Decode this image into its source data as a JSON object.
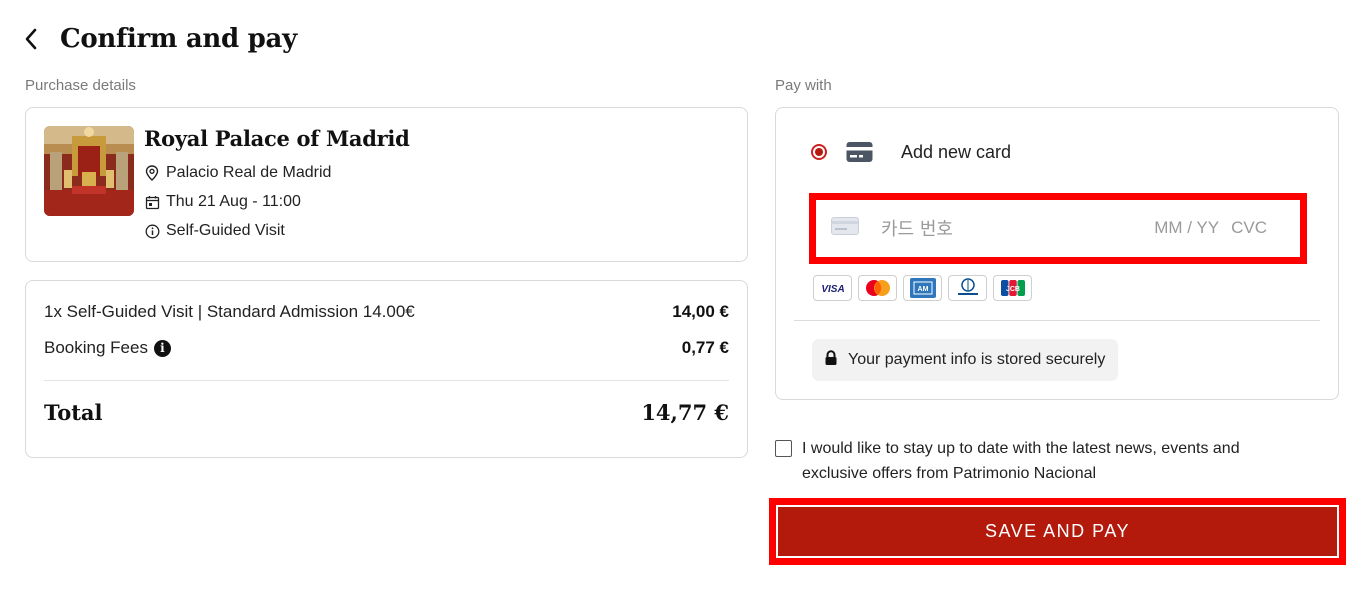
{
  "header": {
    "title": "Confirm and pay",
    "back_icon": "chevron-left-icon"
  },
  "purchase": {
    "section_label": "Purchase details",
    "venue_name": "Royal Palace of Madrid",
    "location": "Palacio Real de Madrid",
    "datetime": "Thu 21 Aug - 11:00",
    "visit_type": "Self-Guided Visit",
    "icons": {
      "location": "location-pin-icon",
      "date": "calendar-icon",
      "visit": "info-circle-icon"
    }
  },
  "pricing": {
    "items": [
      {
        "label": "1x Self-Guided Visit | Standard Admission 14.00€",
        "amount": "14,00 €"
      },
      {
        "label": "Booking Fees",
        "amount": "0,77 €"
      }
    ],
    "total_label": "Total",
    "total_amount": "14,77 €"
  },
  "payment": {
    "section_label": "Pay with",
    "add_card_label": "Add new card",
    "card_number_placeholder": "카드 번호",
    "expiry_placeholder": "MM / YY",
    "cvc_placeholder": "CVC",
    "brands": [
      "VISA",
      "Mastercard",
      "American Express",
      "Diners Club",
      "JCB"
    ],
    "secure_note": "Your payment info is stored securely"
  },
  "optin": {
    "label": "I would like to stay up to date with the latest news, events and exclusive offers from Patrimonio Nacional",
    "checked": false
  },
  "pay_button": {
    "label": "SAVE AND PAY"
  },
  "colors": {
    "accent": "#b31a0b",
    "highlight": "#ff0000",
    "text": "#1a1a1a",
    "muted": "#7a7a7a"
  }
}
